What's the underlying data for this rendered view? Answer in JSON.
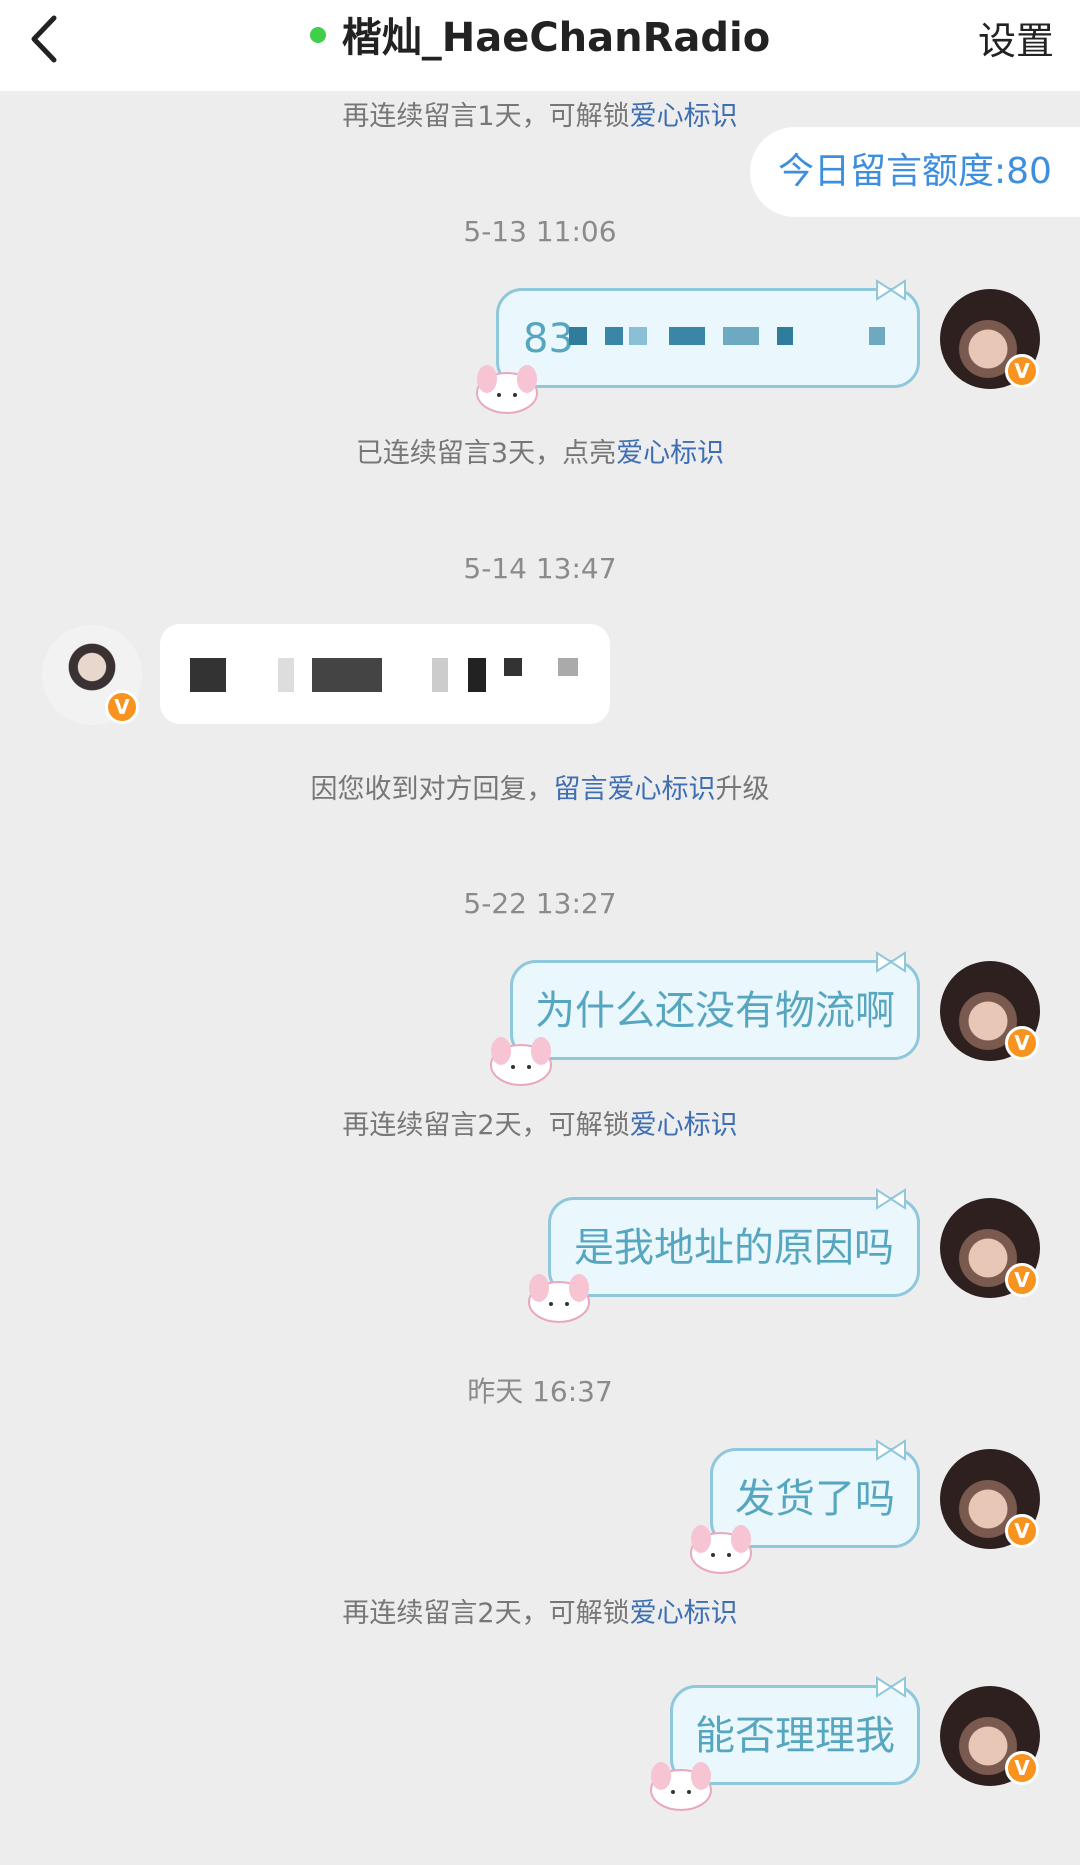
{
  "header": {
    "back_label": "<",
    "title": "楷灿_HaeChanRadio",
    "settings_label": "设置"
  },
  "quota": "今日留言额度:80",
  "notices": {
    "n1": {
      "pre": "再连续留言1天，可解锁",
      "hl": "爱心标识",
      "post": ""
    },
    "n2": {
      "pre": "已连续留言3天，点亮",
      "hl": "爱心标识",
      "post": ""
    },
    "n3": {
      "pre": "因您收到对方回复，",
      "hl": "留言爱心标识",
      "post": "升级"
    },
    "n4": {
      "pre": "再连续留言2天，可解锁",
      "hl": "爱心标识",
      "post": ""
    },
    "n5": {
      "pre": "再连续留言2天，可解锁",
      "hl": "爱心标识",
      "post": ""
    }
  },
  "timestamps": {
    "t1": "5-13 11:06",
    "t2": "5-14 13:47",
    "t3": "5-22 13:27",
    "t4": "昨天 16:37"
  },
  "messages": {
    "m1": "83",
    "m2": "为什么还没有物流啊",
    "m3": "是我地址的原因吗",
    "m4": "发货了吗",
    "m5": "能否理理我"
  },
  "badge": "V",
  "colors": {
    "accent_blue": "#3e8ede",
    "highlight_blue": "#3f6fb3",
    "bubble_text": "#57a6bf",
    "bubble_fill": "#eaf7fc",
    "online_green": "#3fcf4a",
    "verified_orange": "#f7931e"
  }
}
